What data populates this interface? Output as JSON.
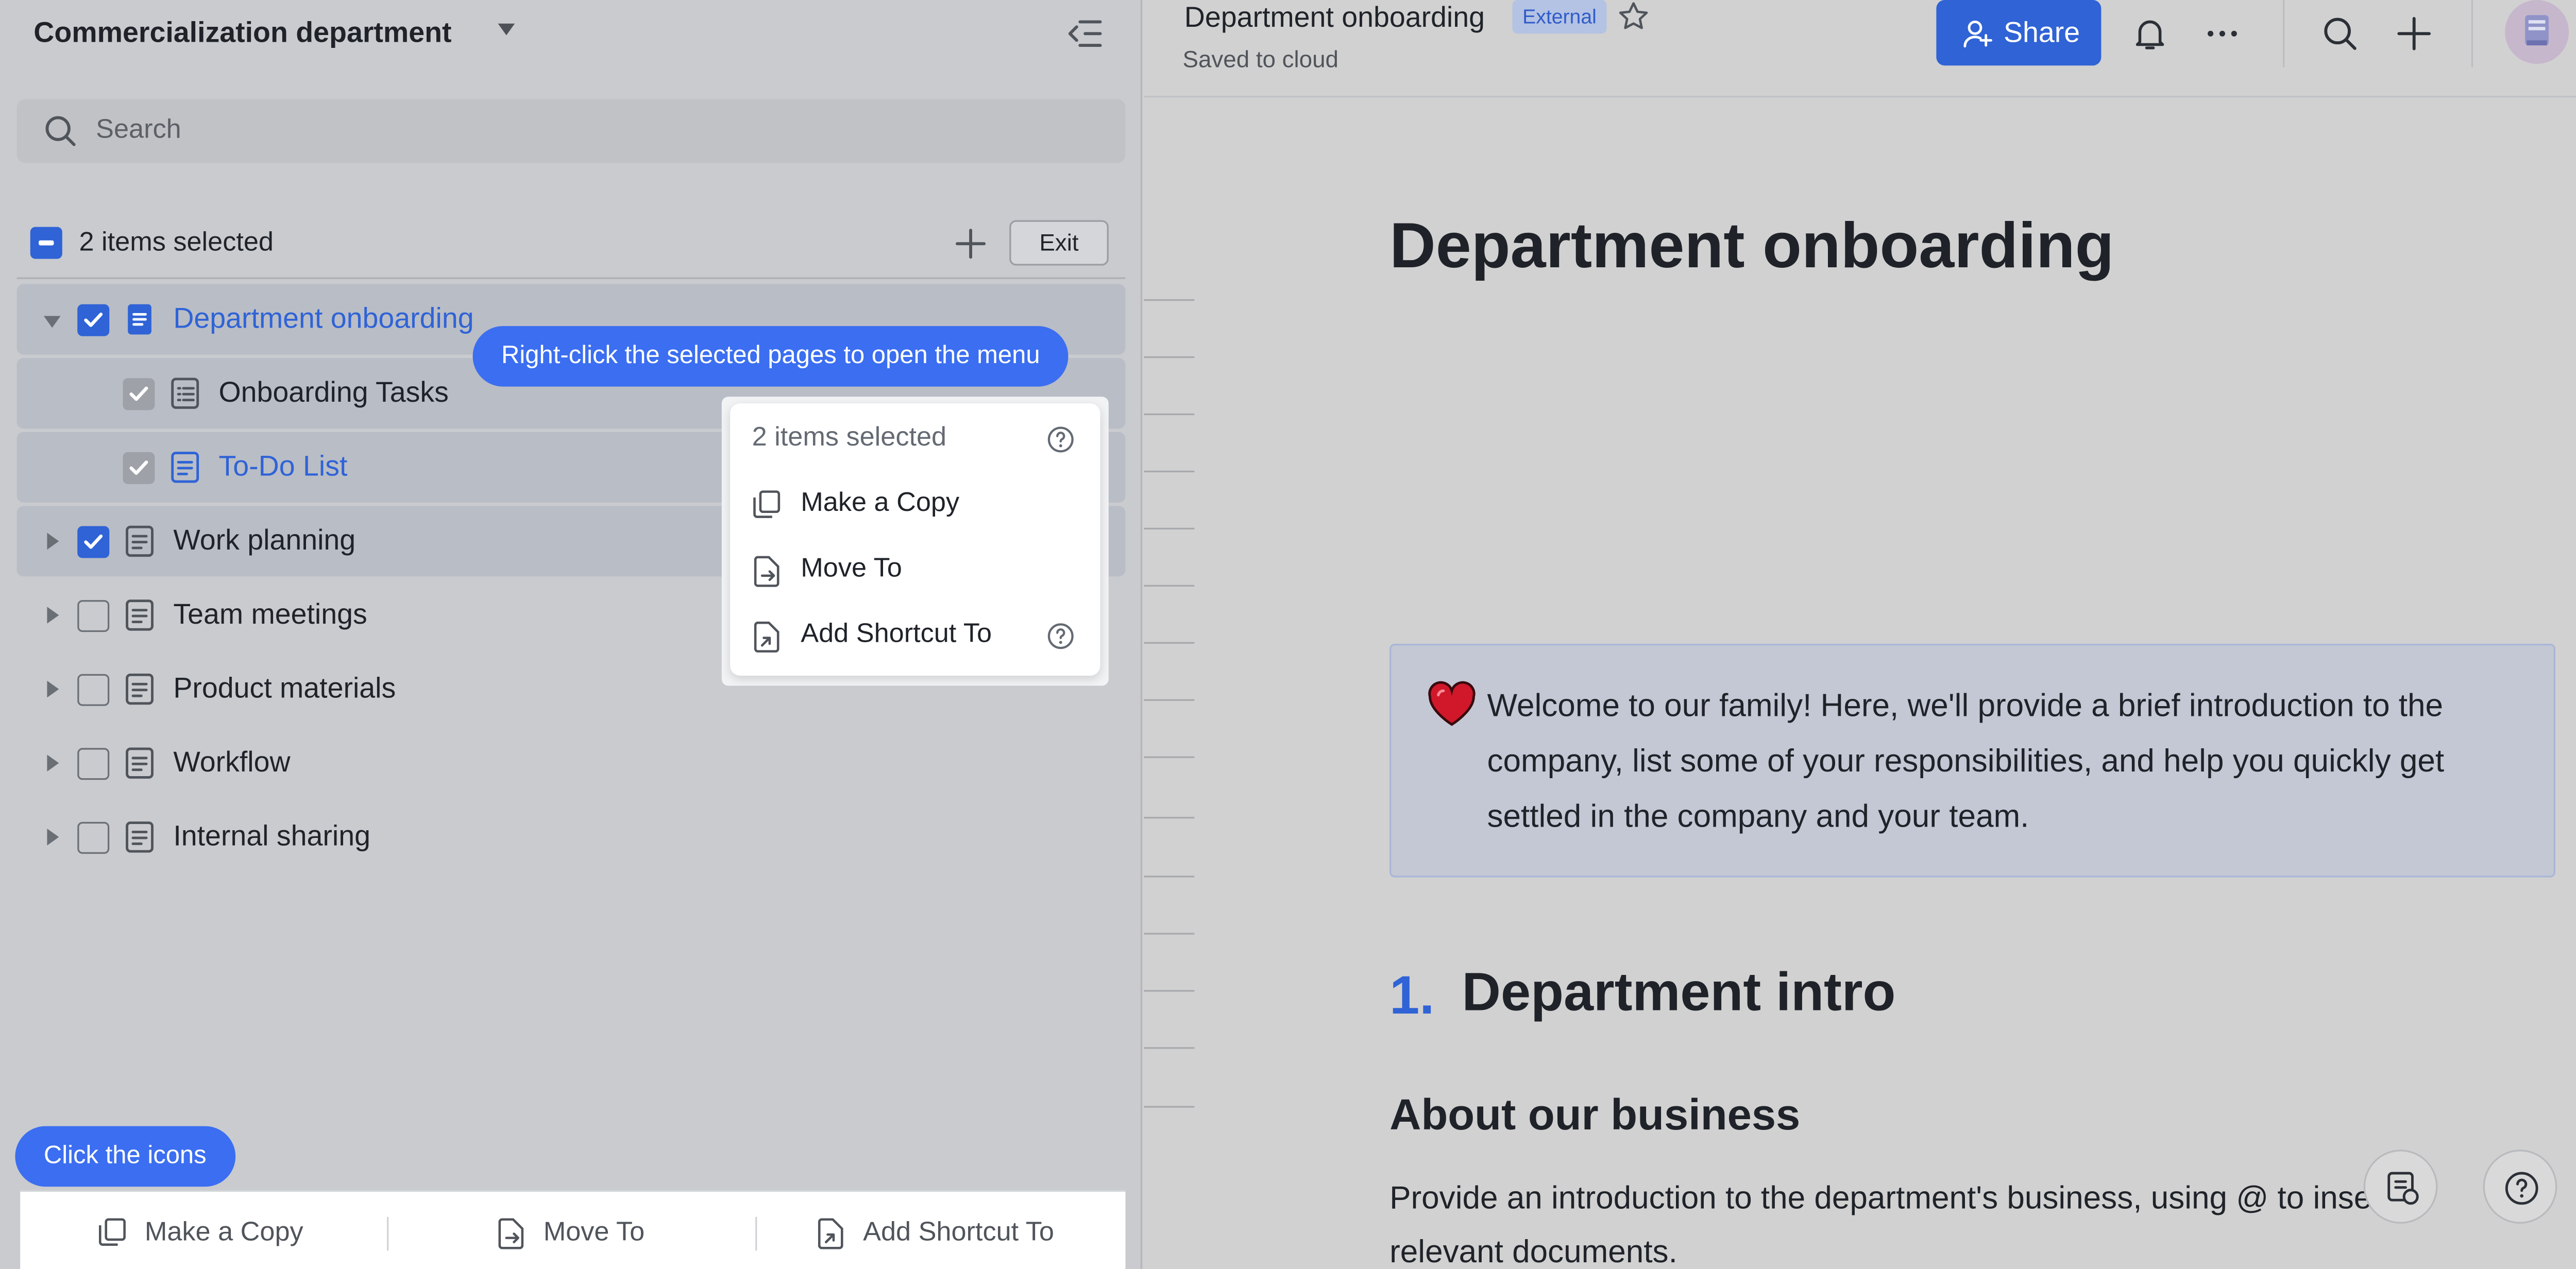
{
  "sidebar": {
    "workspace_title": "Commercialization department",
    "search_placeholder": "Search",
    "selection_count": "2 items selected",
    "exit_label": "Exit",
    "tree": [
      {
        "label": "Department onboarding",
        "checked": true,
        "expanded": true
      },
      {
        "label": "Onboarding Tasks",
        "checked": true
      },
      {
        "label": "To-Do List",
        "checked": true
      },
      {
        "label": "Work planning",
        "checked": true
      },
      {
        "label": "Team meetings",
        "checked": false
      },
      {
        "label": "Product materials",
        "checked": false
      },
      {
        "label": "Workflow",
        "checked": false
      },
      {
        "label": "Internal sharing",
        "checked": false
      }
    ],
    "tooltip_rightclick": "Right-click the selected pages to open the menu",
    "tooltip_icons": "Click the icons",
    "context_menu": {
      "header": "2 items selected",
      "items": [
        "Make a Copy",
        "Move To",
        "Add Shortcut To"
      ]
    },
    "bottom_bar": [
      "Make a Copy",
      "Move To",
      "Add Shortcut To"
    ]
  },
  "doc": {
    "title": "Department onboarding",
    "tag": "External",
    "status": "Saved to cloud",
    "share_label": "Share",
    "heading": "Department onboarding",
    "callout": "Welcome to our family! Here, we'll provide a brief introduction to the company, list some of your responsibilities, and help you quickly get settled in the company and your team.",
    "section_number": "1.",
    "section_title": "Department intro",
    "subsection_title": "About our business",
    "paragraph": "Provide an introduction to the department's business, using @ to insert relevant documents."
  },
  "colors": {
    "accent": "#2f63d6",
    "tooltip": "#3b6ef0",
    "sidebar_bg": "#c9cbcf",
    "doc_bg": "#d1d1d1"
  }
}
